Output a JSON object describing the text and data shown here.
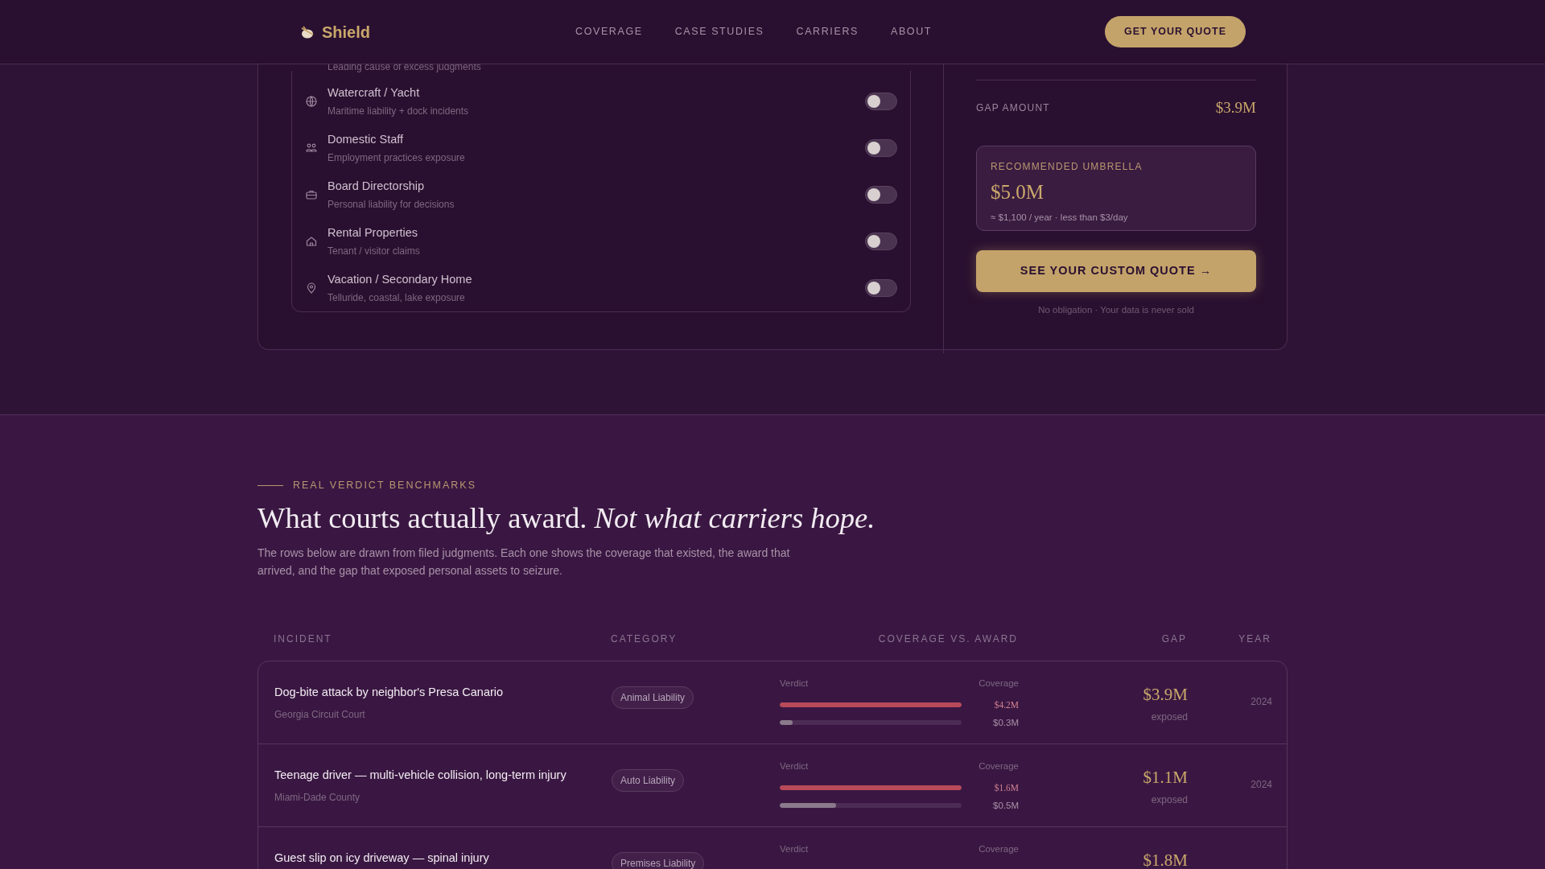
{
  "nav": {
    "brand": "Shield",
    "links": [
      "COVERAGE",
      "CASE STUDIES",
      "CARRIERS",
      "ABOUT"
    ],
    "cta": "GET YOUR QUOTE"
  },
  "exposures": {
    "partial_description": "Leading cause of excess judgments",
    "items": [
      {
        "title": "Watercraft / Yacht",
        "description": "Maritime liability + dock incidents",
        "on": false
      },
      {
        "title": "Domestic Staff",
        "description": "Employment practices exposure",
        "on": false
      },
      {
        "title": "Board Directorship",
        "description": "Personal liability for decisions",
        "on": false
      },
      {
        "title": "Rental Properties",
        "description": "Tenant / visitor claims",
        "on": false
      },
      {
        "title": "Vacation / Secondary Home",
        "description": "Telluride, coastal, lake exposure",
        "on": false
      }
    ]
  },
  "summary": {
    "rows": [
      {
        "label": "GAP AMOUNT",
        "value": "$3.9M"
      }
    ],
    "recommendation": {
      "label": "RECOMMENDED UMBRELLA",
      "amount": "$5.0M",
      "note": "≈ $1,100 / year · less than $3/day"
    },
    "button": "SEE YOUR CUSTOM QUOTE →",
    "footnote": "No obligation · Your data is never sold"
  },
  "benchmarks": {
    "eyebrow": "REAL VERDICT BENCHMARKS",
    "title": "What courts actually award. *Not what carriers hope.*",
    "intro": "The rows below are drawn from filed judgments. Each one shows the coverage that existed, the award that arrived, and the gap that exposed personal assets to seizure.",
    "columns": [
      "INCIDENT",
      "CATEGORY",
      "COVERAGE VS. AWARD",
      "GAP",
      "YEAR"
    ],
    "rows": [
      {
        "incident": "Dog-bite attack by neighbor's Presa Canario",
        "court": "Georgia Circuit Court",
        "category": "Animal Liability",
        "verdict_label": "Verdict",
        "coverage_label": "Coverage",
        "bars": [
          {
            "kind": "verdict",
            "level": 1,
            "value": "$4.2M"
          },
          {
            "kind": "coverage",
            "level": 0.07,
            "value": "$0.3M"
          }
        ],
        "gap": "$3.9M",
        "gap_note": "exposed",
        "year": "2024"
      },
      {
        "incident": "Teenage driver — multi-vehicle collision, long-term injury",
        "court": "Miami-Dade County",
        "category": "Auto Liability",
        "verdict_label": "Verdict",
        "coverage_label": "Coverage",
        "bars": [
          {
            "kind": "verdict",
            "level": 1,
            "value": "$1.6M"
          },
          {
            "kind": "coverage",
            "level": 0.31,
            "value": "$0.5M"
          }
        ],
        "gap": "$1.1M",
        "gap_note": "exposed",
        "year": "2024"
      },
      {
        "incident": "Guest slip on icy driveway — spinal injury",
        "category": "Premises Liability",
        "verdict_label": "Verdict",
        "coverage_label": "Coverage",
        "bars": [],
        "gap": "$1.8M"
      }
    ]
  }
}
